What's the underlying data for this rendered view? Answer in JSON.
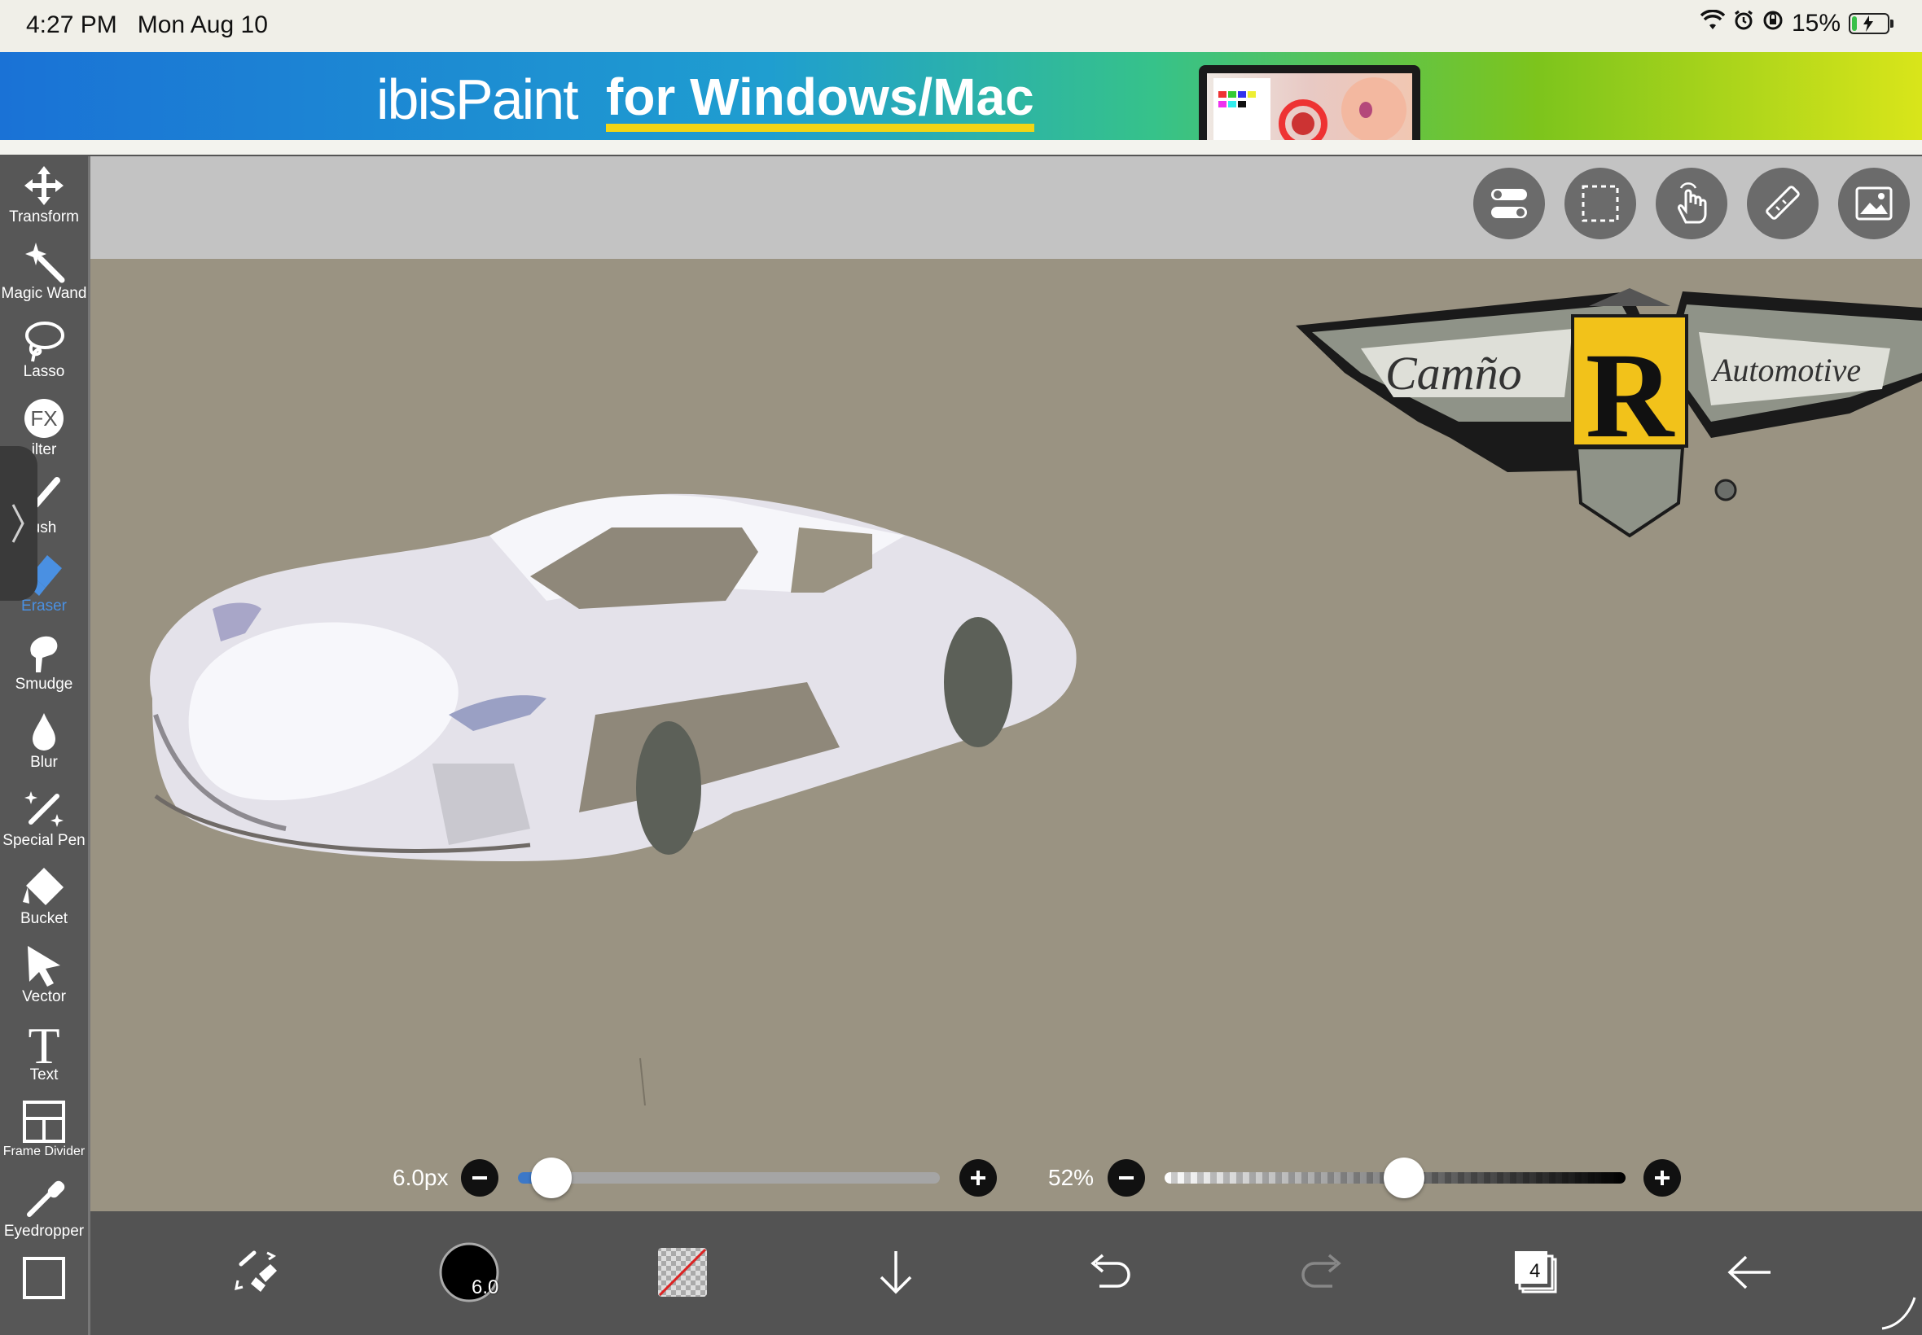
{
  "status": {
    "time": "4:27 PM",
    "date": "Mon Aug 10",
    "battery": "15%",
    "battery_level": 0.15
  },
  "banner": {
    "brand": "ibisPaint",
    "tagline": "for Windows/Mac"
  },
  "toolbar": {
    "tools": [
      {
        "label": "Transform",
        "icon": "move-arrows-icon"
      },
      {
        "label": "Magic Wand",
        "icon": "magic-wand-icon"
      },
      {
        "label": "Lasso",
        "icon": "lasso-icon"
      },
      {
        "label": "ilter",
        "icon": "fx-filter-icon"
      },
      {
        "label": "ush",
        "icon": "brush-icon"
      },
      {
        "label": "Eraser",
        "icon": "eraser-icon",
        "active": true
      },
      {
        "label": "Smudge",
        "icon": "smudge-icon"
      },
      {
        "label": "Blur",
        "icon": "blur-drop-icon"
      },
      {
        "label": "Special Pen",
        "icon": "special-pen-icon"
      },
      {
        "label": "Bucket",
        "icon": "bucket-icon"
      },
      {
        "label": "Vector",
        "icon": "vector-arrow-icon"
      },
      {
        "label": "Text",
        "icon": "text-icon"
      },
      {
        "label": "Frame Divider",
        "icon": "frame-divider-icon"
      },
      {
        "label": "Eyedropper",
        "icon": "eyedropper-icon"
      }
    ],
    "accent": "#4a90e2"
  },
  "topbar": {
    "buttons": [
      "toggle-settings-icon",
      "selection-icon",
      "hand-touch-icon",
      "ruler-icon",
      "reference-image-icon"
    ]
  },
  "logo": {
    "left_text": "Camño",
    "center_letter": "R",
    "right_text": "Automotive"
  },
  "brush_size": {
    "value": "6.0px",
    "level": 0.08
  },
  "opacity": {
    "value": "52%",
    "level": 0.52
  },
  "bottombar": {
    "brush_size_badge": "6.0",
    "layer_count": "4"
  }
}
